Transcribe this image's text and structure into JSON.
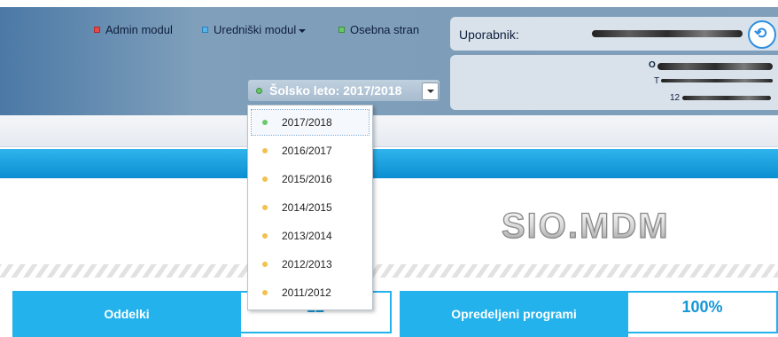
{
  "nav": {
    "admin": "Admin modul",
    "editor": "Uredniški modul",
    "personal": "Osebna stran"
  },
  "user": {
    "label": "Uporabnik:",
    "info_prefix_1": "O",
    "info_prefix_2": "T",
    "info_prefix_3": "12"
  },
  "school_year": {
    "selected": "Šolsko leto: 2017/2018",
    "options": [
      {
        "label": "2017/2018",
        "status": "current"
      },
      {
        "label": "2016/2017",
        "status": "past"
      },
      {
        "label": "2015/2016",
        "status": "past"
      },
      {
        "label": "2014/2015",
        "status": "past"
      },
      {
        "label": "2013/2014",
        "status": "past"
      },
      {
        "label": "2012/2013",
        "status": "past"
      },
      {
        "label": "2011/2012",
        "status": "past"
      }
    ]
  },
  "logo": {
    "text": "SIO.MDM"
  },
  "stats": [
    {
      "label": "Oddelki",
      "value": "12"
    },
    {
      "label": "Opredeljeni programi",
      "value": "100%"
    }
  ],
  "colors": {
    "accent": "#24b2ec",
    "current_dot": "#6cc96d",
    "past_dot": "#f2c14e"
  }
}
